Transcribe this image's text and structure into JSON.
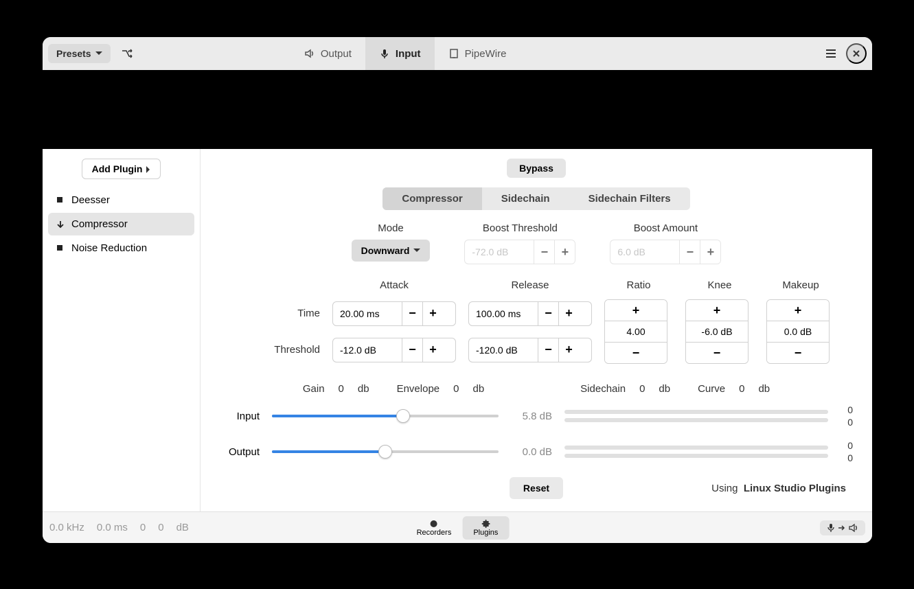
{
  "titlebar": {
    "presets": "Presets",
    "tabs": {
      "output": "Output",
      "input": "Input",
      "pipewire": "PipeWire"
    }
  },
  "sidebar": {
    "add": "Add Plugin",
    "items": [
      {
        "label": "Deesser"
      },
      {
        "label": "Compressor"
      },
      {
        "label": "Noise Reduction"
      }
    ]
  },
  "content": {
    "bypass": "Bypass",
    "subtabs": {
      "comp": "Compressor",
      "side": "Sidechain",
      "filt": "Sidechain Filters"
    },
    "mode": {
      "label": "Mode",
      "value": "Downward"
    },
    "boost_thresh": {
      "label": "Boost Threshold",
      "value": "-72.0 dB"
    },
    "boost_amt": {
      "label": "Boost Amount",
      "value": "6.0 dB"
    },
    "attack": "Attack",
    "release": "Release",
    "ratio": "Ratio",
    "knee": "Knee",
    "makeup": "Makeup",
    "time": "Time",
    "threshold": "Threshold",
    "attack_time": "20.00 ms",
    "release_time": "100.00 ms",
    "attack_thresh": "-12.0 dB",
    "release_thresh": "-120.0 dB",
    "ratio_val": "4.00",
    "knee_val": "-6.0 dB",
    "makeup_val": "0.0 dB",
    "meters": {
      "gain": {
        "label": "Gain",
        "val": "0",
        "unit": "db"
      },
      "envelope": {
        "label": "Envelope",
        "val": "0",
        "unit": "db"
      },
      "sidechain": {
        "label": "Sidechain",
        "val": "0",
        "unit": "db"
      },
      "curve": {
        "label": "Curve",
        "val": "0",
        "unit": "db"
      }
    },
    "sliders": {
      "input": {
        "label": "Input",
        "value": "5.8 dB",
        "bar1": "0",
        "bar2": "0"
      },
      "output": {
        "label": "Output",
        "value": "0.0 dB",
        "bar1": "0",
        "bar2": "0"
      }
    },
    "reset": "Reset",
    "using": "Using",
    "using_name": "Linux Studio Plugins"
  },
  "footer": {
    "khz": "0.0 kHz",
    "ms": "0.0 ms",
    "v1": "0",
    "v2": "0",
    "db": "dB",
    "recorders": "Recorders",
    "plugins": "Plugins"
  }
}
